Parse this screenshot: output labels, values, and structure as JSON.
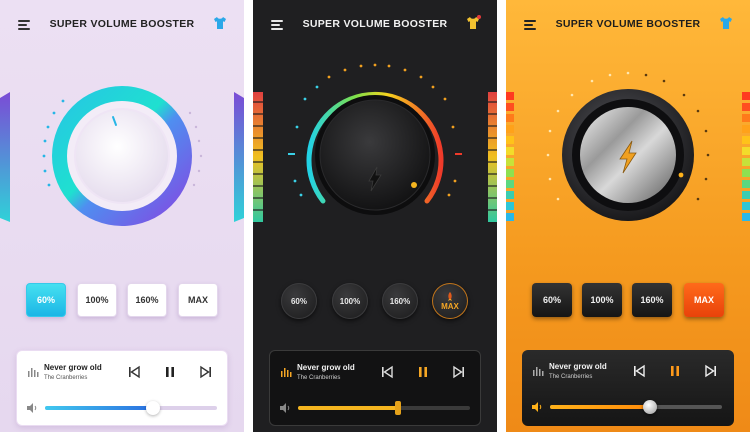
{
  "screens": [
    {
      "theme": "light",
      "app_title": "SUPER VOLUME BOOSTER",
      "presets": [
        "60%",
        "100%",
        "160%",
        "MAX"
      ],
      "active_preset": "60%",
      "song_title": "Never grow old",
      "song_artist": "The Cranberries",
      "volume_level": 0.63,
      "accent": "#1bb6e6"
    },
    {
      "theme": "dark",
      "app_title": "SUPER VOLUME BOOSTER",
      "presets": [
        "60%",
        "100%",
        "160%",
        "MAX"
      ],
      "active_preset": "MAX",
      "song_title": "Never grow old",
      "song_artist": "The Cranberries",
      "volume_level": 0.58,
      "accent": "#f5a624"
    },
    {
      "theme": "orange",
      "app_title": "SUPER VOLUME BOOSTER",
      "presets": [
        "60%",
        "100%",
        "160%",
        "MAX"
      ],
      "active_preset": "MAX",
      "song_title": "Never grow old",
      "song_artist": "The Cranberries",
      "volume_level": 0.58,
      "accent": "#e9420a"
    }
  ],
  "icons": {
    "menu": "hamburger-menu-icon",
    "theme": "tshirt-theme-icon",
    "music": "music-note-icon",
    "previous": "skip-previous-icon",
    "pause": "pause-icon",
    "next": "skip-next-icon",
    "volume": "speaker-volume-icon",
    "boost": "lightning-bolt-icon",
    "rocket": "rocket-icon"
  }
}
